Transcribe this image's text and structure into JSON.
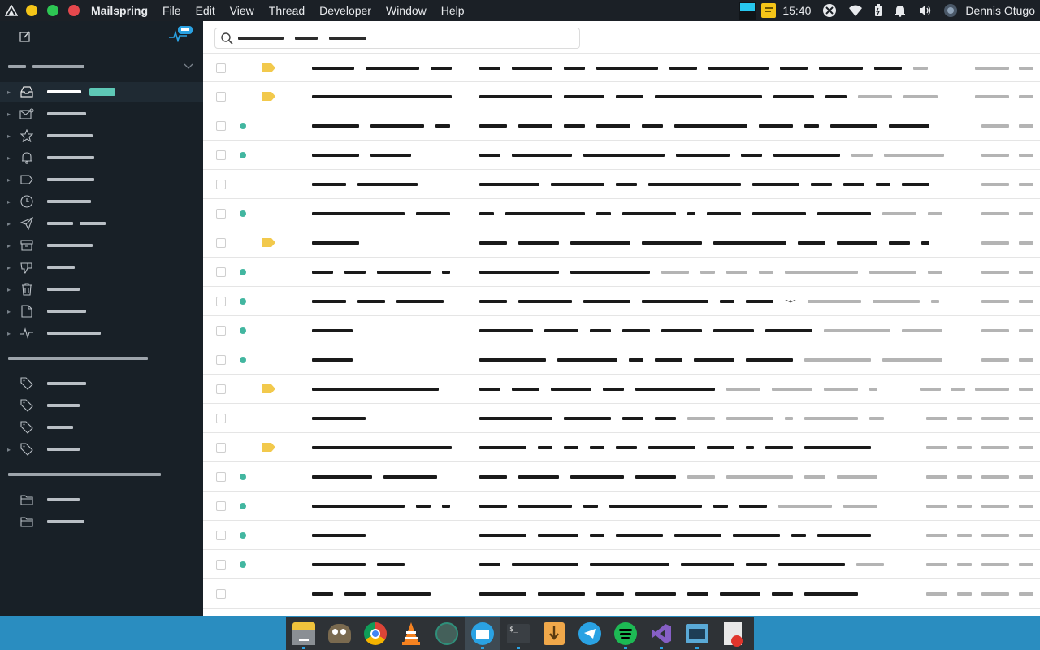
{
  "topbar": {
    "app_name": "Mailspring",
    "menus": [
      "File",
      "Edit",
      "View",
      "Thread",
      "Developer",
      "Window",
      "Help"
    ],
    "time": "15:40",
    "user": "Dennis Otugo",
    "traffic_colors": [
      "#f5c518",
      "#2dc653",
      "#e5484d"
    ]
  },
  "sidebar": {
    "unread_badge_color": "#2aa2e3",
    "items": [
      {
        "icon": "inbox-icon",
        "active": true
      },
      {
        "icon": "unread-mail-icon"
      },
      {
        "icon": "star-icon"
      },
      {
        "icon": "bell-icon"
      },
      {
        "icon": "label-icon"
      },
      {
        "icon": "clock-icon"
      },
      {
        "icon": "sent-icon"
      },
      {
        "icon": "archive-icon"
      },
      {
        "icon": "spam-icon"
      },
      {
        "icon": "trash-icon"
      },
      {
        "icon": "document-icon"
      },
      {
        "icon": "activity-icon"
      }
    ],
    "labels": [
      {
        "icon": "tag-icon"
      },
      {
        "icon": "tag-icon"
      },
      {
        "icon": "tag-icon"
      },
      {
        "icon": "tag-icon"
      }
    ],
    "folders": [
      {
        "icon": "folder-icon"
      },
      {
        "icon": "folder-icon"
      }
    ]
  },
  "search": {
    "icon": "search-icon"
  },
  "threads": {
    "count": 19,
    "unread_dot_color": "#42b6a0",
    "label_color": "#f2c94c"
  },
  "dock": {
    "apps": [
      "files-icon",
      "gimp-icon",
      "chrome-icon",
      "vlc-icon",
      "krita-icon",
      "mailspring-icon",
      "terminal-icon",
      "downloader-icon",
      "telegram-icon",
      "spotify-icon",
      "visual-studio-icon",
      "remote-desktop-icon",
      "text-editor-icon"
    ],
    "active_index": 5
  }
}
